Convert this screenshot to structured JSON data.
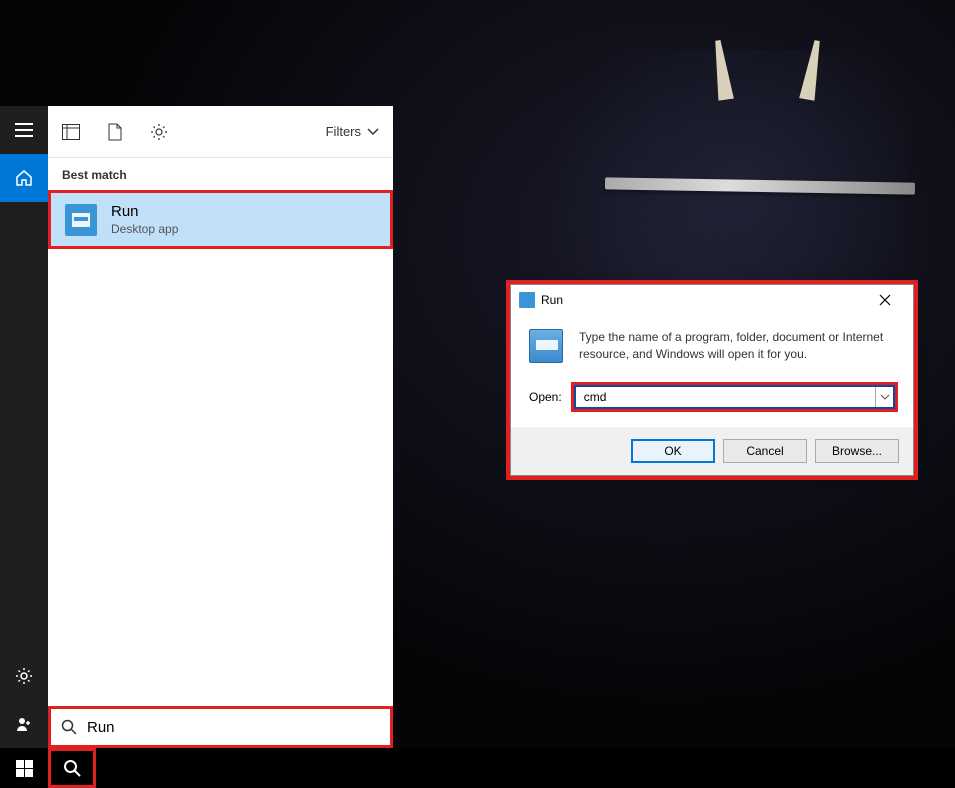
{
  "search_panel": {
    "filters_label": "Filters",
    "section_label": "Best match",
    "result": {
      "title": "Run",
      "subtitle": "Desktop app"
    },
    "search_value": "Run"
  },
  "run_dialog": {
    "title": "Run",
    "description": "Type the name of a program, folder, document or Internet resource, and Windows will open it for you.",
    "open_label": "Open:",
    "open_value": "cmd",
    "buttons": {
      "ok": "OK",
      "cancel": "Cancel",
      "browse": "Browse..."
    }
  }
}
